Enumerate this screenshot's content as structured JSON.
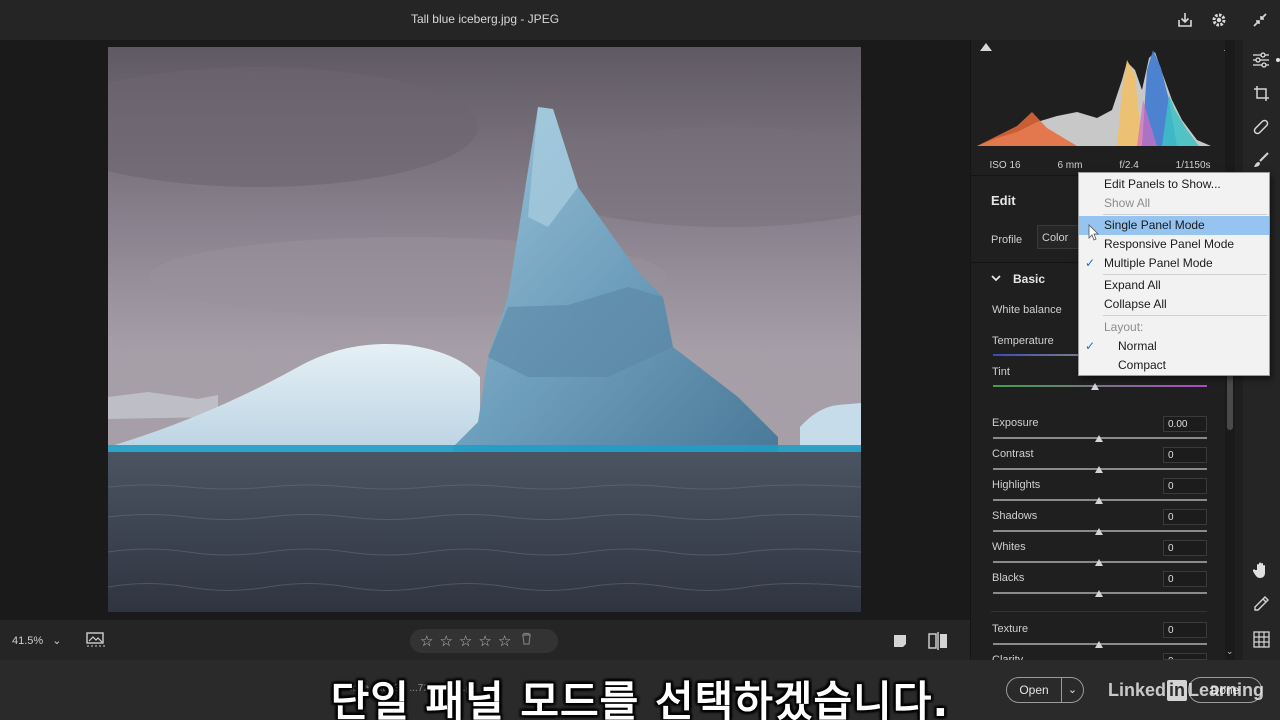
{
  "window": {
    "title": "Tall blue iceberg.jpg  -  JPEG"
  },
  "histogram": {
    "exif": [
      "ISO 16",
      "6 mm",
      "f/2.4",
      "1/1150s"
    ]
  },
  "panel": {
    "edit_label": "Edit",
    "profile_label": "Profile",
    "profile_value": "Color",
    "basic_label": "Basic",
    "white_balance_label": "White balance",
    "controls": [
      {
        "label": "Temperature",
        "value": ""
      },
      {
        "label": "Tint",
        "value": ""
      },
      {
        "label": "Exposure",
        "value": "0.00"
      },
      {
        "label": "Contrast",
        "value": "0"
      },
      {
        "label": "Highlights",
        "value": "0"
      },
      {
        "label": "Shadows",
        "value": "0"
      },
      {
        "label": "Whites",
        "value": "0"
      },
      {
        "label": "Blacks",
        "value": "0"
      },
      {
        "label": "Texture",
        "value": "0"
      },
      {
        "label": "Clarity",
        "value": "0"
      }
    ]
  },
  "menu": {
    "items": [
      {
        "label": "Edit Panels to Show...",
        "state": "normal"
      },
      {
        "label": "Show All",
        "state": "disabled"
      },
      {
        "label": "Single Panel Mode",
        "state": "highlight"
      },
      {
        "label": "Responsive Panel Mode",
        "state": "normal"
      },
      {
        "label": "Multiple Panel Mode",
        "state": "checked"
      },
      {
        "label": "Expand All",
        "state": "normal"
      },
      {
        "label": "Collapse All",
        "state": "normal"
      },
      {
        "label": "Layout:",
        "state": "disabled"
      },
      {
        "label": "Normal",
        "state": "checked"
      },
      {
        "label": "Compact",
        "state": "normal"
      }
    ]
  },
  "bottom": {
    "zoom": "41.5%",
    "stars": 5,
    "underlay_text": "lobe   ...it - 3C   ...72   ...MT   ...pl",
    "open_label": "Open",
    "done_label": "Done"
  },
  "caption": {
    "subtitle": "단일 패널 모드를 선택하겠습니다."
  },
  "watermark": {
    "left": "Linked",
    "in": "in",
    "right": "Learning"
  },
  "colors": {
    "accent": "#94c4ef",
    "check": "#1f6fc1"
  }
}
